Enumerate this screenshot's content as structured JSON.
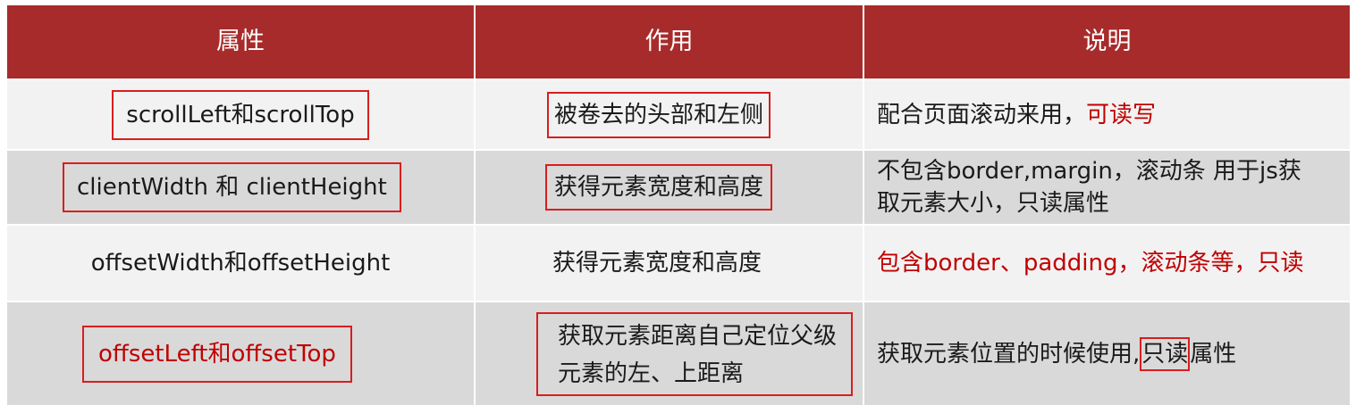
{
  "header": {
    "col1": "属性",
    "col2": "作用",
    "col3": "说明"
  },
  "rows": [
    {
      "property": "scrollLeft和scrollTop",
      "effect": "被卷去的头部和左侧",
      "desc_plain": "配合页面滚动来用，",
      "desc_red": "可读写"
    },
    {
      "property": "clientWidth 和 clientHeight",
      "effect": "获得元素宽度和高度",
      "desc": "不包含border,margin，滚动条 用于js获取元素大小，只读属性"
    },
    {
      "property": "offsetWidth和offsetHeight",
      "effect": "获得元素宽度和高度",
      "desc": "包含border、padding，滚动条等，只读"
    },
    {
      "property": "offsetLeft和offsetTop",
      "effect": "获取元素距离自己定位父级元素的左、上距离",
      "desc_before": "获取元素位置的时候使用,",
      "desc_mark": "只读",
      "desc_after": "属性"
    }
  ],
  "colors": {
    "header_bg": "#a82b2b",
    "row_light": "#f2f2f2",
    "row_dark": "#d9d9d9",
    "highlight_red": "#c00000",
    "box_border": "#d81e1e"
  }
}
